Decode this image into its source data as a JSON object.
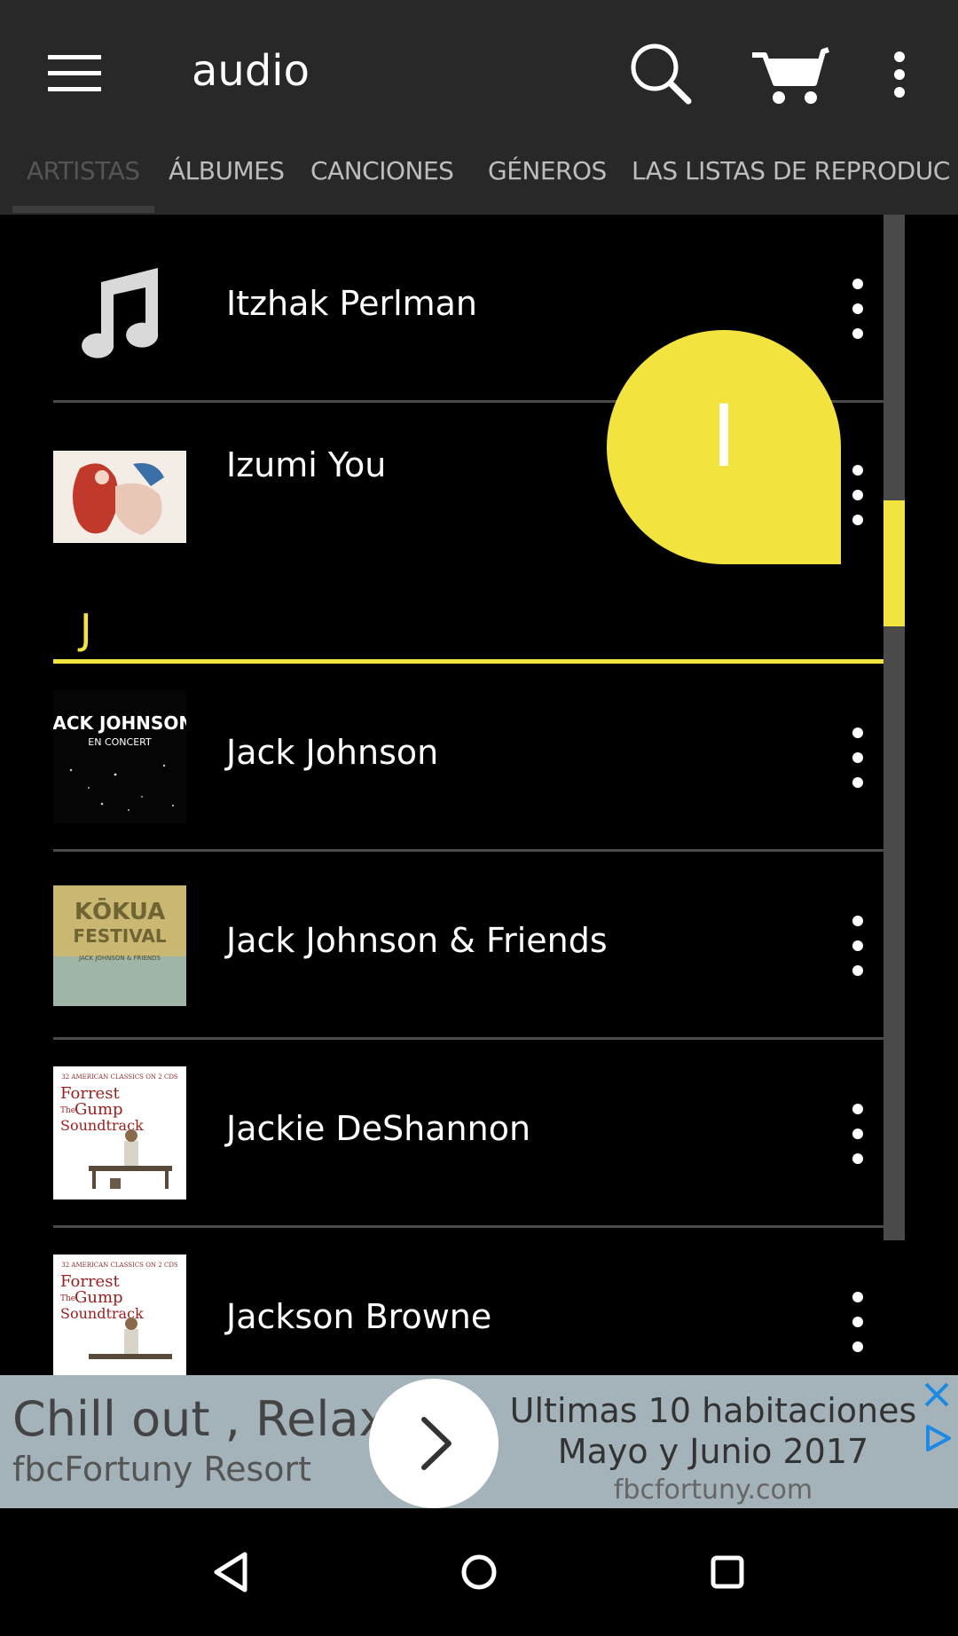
{
  "app_bar": {
    "title": "audio",
    "icons": [
      "menu-icon",
      "search-icon",
      "cart-icon",
      "more-vert-icon"
    ]
  },
  "tabs": [
    {
      "label": "ARTISTAS",
      "active": true
    },
    {
      "label": "ÁLBUMES",
      "active": false
    },
    {
      "label": "CANCIONES",
      "active": false
    },
    {
      "label": "GÉNEROS",
      "active": false
    },
    {
      "label": "LAS LISTAS DE REPRODUC",
      "active": false
    }
  ],
  "artists": [
    {
      "name": "Itzhak Perlman",
      "art": "music-note-icon"
    },
    {
      "name": "Izumi You",
      "art": "album-art"
    },
    {
      "name": "Jack Johnson",
      "art": "album-art",
      "art_text": [
        "JACK JOHNSON",
        "EN CONCERT"
      ]
    },
    {
      "name": "Jack Johnson & Friends",
      "art": "album-art",
      "art_text": [
        "KŌKUA",
        "FESTIVAL",
        "JACK JOHNSON & FRIENDS"
      ]
    },
    {
      "name": "Jackie DeShannon",
      "art": "album-art",
      "art_text": [
        "32 AMERICAN CLASSICS ON 2 CDS",
        "Forrest",
        "The",
        "Gump",
        "Soundtrack"
      ]
    },
    {
      "name": "Jackson Browne",
      "art": "album-art",
      "art_text": [
        "32 AMERICAN CLASSICS ON 2 CDS",
        "Forrest",
        "The",
        "Gump",
        "Soundtrack"
      ]
    }
  ],
  "section_letter": "J",
  "fast_scroll_letter": "I",
  "accent_color": "#f2e33f",
  "ad": {
    "headline": "Chill out , Relax",
    "advertiser": "fbcFortuny Resort",
    "text_line1": "Ultimas 10 habitaciones",
    "text_line2": "Mayo y Junio 2017",
    "domain": "fbcfortuny.com"
  },
  "nav_bar": [
    "back-icon",
    "home-icon",
    "recents-icon"
  ]
}
